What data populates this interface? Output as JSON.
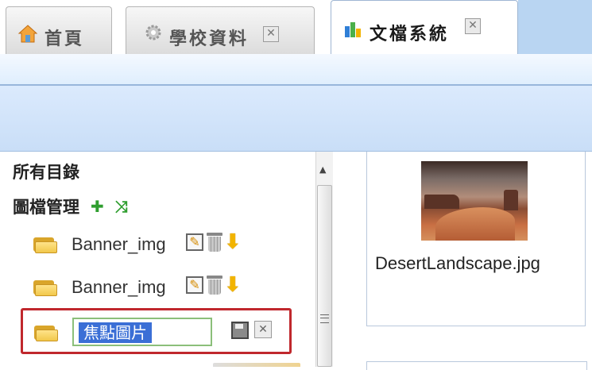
{
  "tabs": [
    {
      "label": "首頁",
      "icon": "home-icon"
    },
    {
      "label": "學校資料",
      "icon": "gear-icon",
      "closable": true
    },
    {
      "label": "文檔系統",
      "icon": "chart-icon",
      "closable": true,
      "active": true
    }
  ],
  "tree": {
    "root_label": "所有目錄",
    "group_label": "圖檔管理",
    "folders": [
      {
        "label": "Banner_img"
      },
      {
        "label": "Banner_img"
      }
    ],
    "edit": {
      "value": "焦點圖片"
    }
  },
  "files": [
    {
      "name": "DesertLandscape.jpg"
    }
  ],
  "colors": {
    "accent_blue": "#c9def7",
    "highlight_red": "#c0282d",
    "selection": "#3b6fd6"
  }
}
